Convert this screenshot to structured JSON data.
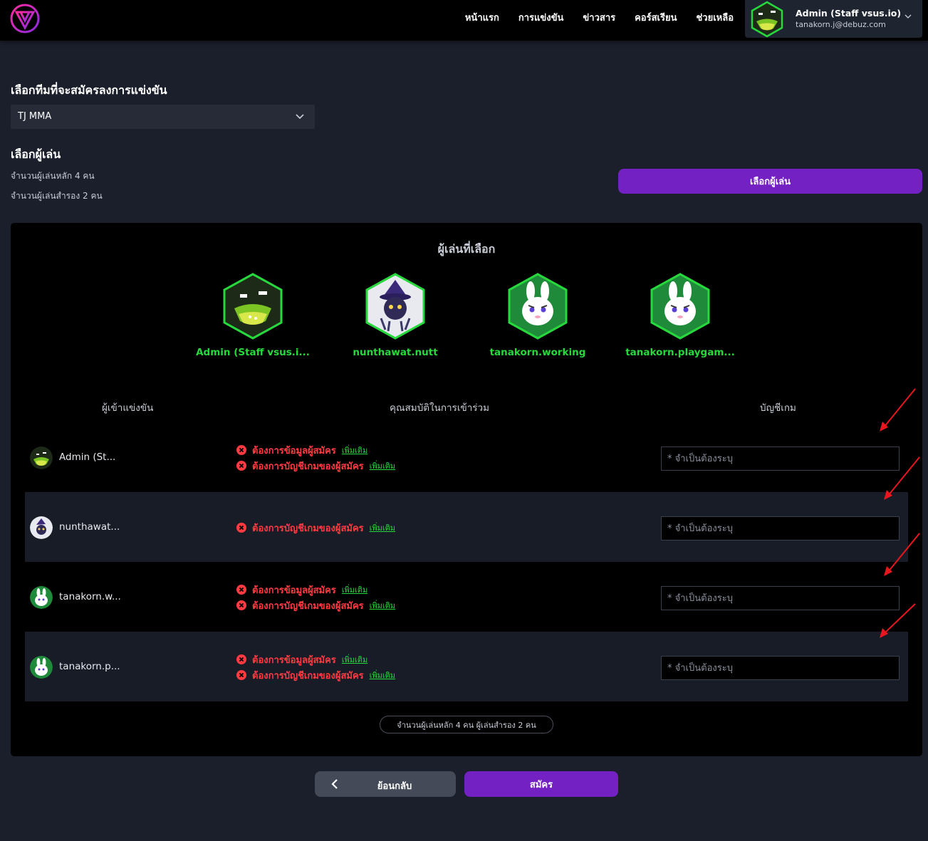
{
  "nav": {
    "links": [
      "หน้าแรก",
      "การแข่งขัน",
      "ข่าวสาร",
      "คอร์สเรียน",
      "ช่วยเหลือ"
    ],
    "user_name": "Admin (Staff vsus.io)",
    "user_email": "tanakorn.j@debuz.com"
  },
  "team_section": {
    "title": "เลือกทีมที่จะสมัครลงการแข่งขัน",
    "selected_team": "TJ MMA"
  },
  "player_section": {
    "title": "เลือกผู้เล่น",
    "main_count": "จำนวนผู้เล่นหลัก 4 คน",
    "sub_count": "จำนวนผู้เล่นสำรอง 2 คน",
    "select_button": "เลือกผู้เล่น"
  },
  "selected_panel": {
    "title": "ผู้เล่นที่เลือก",
    "players": [
      {
        "name": "Admin (Staff vsus.i...",
        "avatar": "landscape-avatar"
      },
      {
        "name": "nunthawat.nutt",
        "avatar": "witch-avatar"
      },
      {
        "name": "tanakorn.working",
        "avatar": "rabbit-avatar"
      },
      {
        "name": "tanakorn.playgam...",
        "avatar": "rabbit-avatar"
      }
    ]
  },
  "table": {
    "headers": [
      "ผู้เข้าแข่งขัน",
      "คุณสมบัติในการเข้าร่วม",
      "บัญชีเกม"
    ],
    "req_info": "ต้องการข้อมูลผู้สมัคร",
    "req_account": "ต้องการบัญชีเกมของผู้สมัคร",
    "more_label": "เพิ่มเติม",
    "account_placeholder": "* จำเป็นต้องระบุ",
    "rows": [
      {
        "name": "Admin (St...",
        "avatar": "landscape-avatar"
      },
      {
        "name": "nunthawat...",
        "avatar": "witch-avatar"
      },
      {
        "name": "tanakorn.w...",
        "avatar": "rabbit-avatar"
      },
      {
        "name": "tanakorn.p...",
        "avatar": "rabbit-avatar"
      }
    ],
    "count_summary": "จำนวนผู้เล่นหลัก 4 คน ผู้เล่นสำรอง 2 คน"
  },
  "footer": {
    "back_label": "ย้อนกลับ",
    "register_label": "สมัคร"
  },
  "colors": {
    "accent": "#7321c2",
    "error": "#ff3b42",
    "success": "#27d93d",
    "background": "#1b1f2c"
  }
}
